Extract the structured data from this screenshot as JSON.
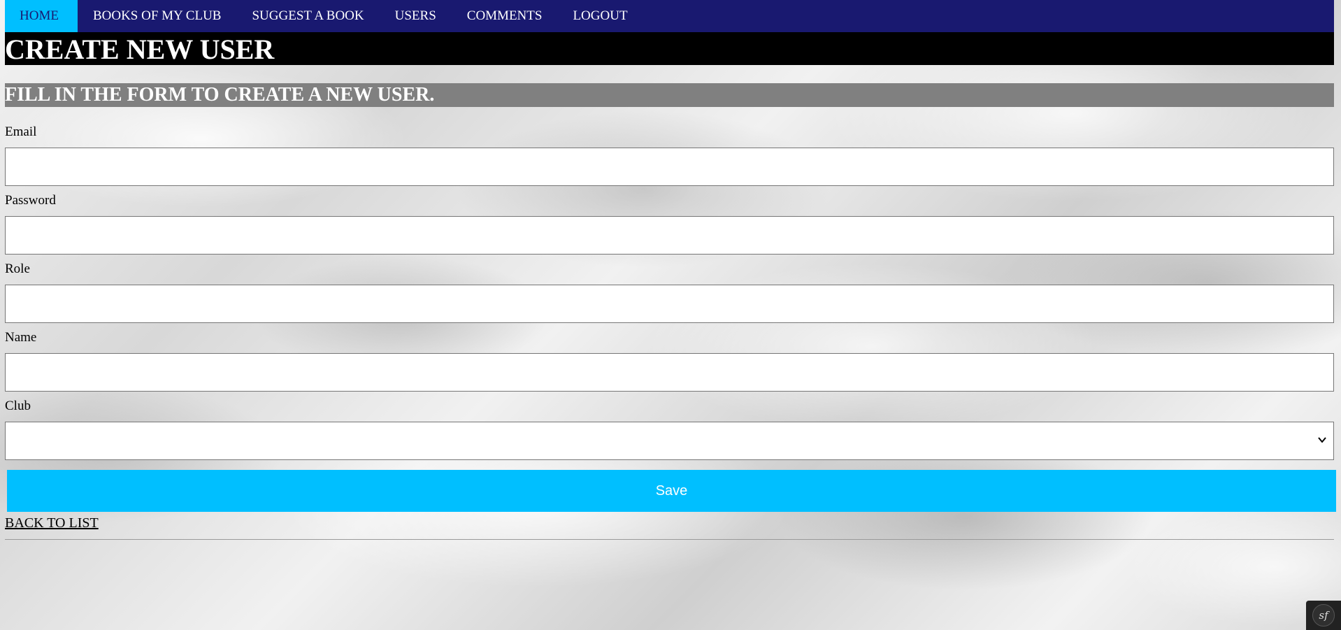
{
  "nav": {
    "items": [
      {
        "label": "HOME",
        "active": true
      },
      {
        "label": "BOOKS OF MY CLUB",
        "active": false
      },
      {
        "label": "SUGGEST A BOOK",
        "active": false
      },
      {
        "label": "USERS",
        "active": false
      },
      {
        "label": "COMMENTS",
        "active": false
      },
      {
        "label": "LOGOUT",
        "active": false
      }
    ]
  },
  "page": {
    "title": "CREATE NEW USER",
    "subtitle": "FILL IN THE FORM TO CREATE A NEW USER."
  },
  "form": {
    "email": {
      "label": "Email",
      "value": ""
    },
    "password": {
      "label": "Password",
      "value": ""
    },
    "role": {
      "label": "Role",
      "value": ""
    },
    "name": {
      "label": "Name",
      "value": ""
    },
    "club": {
      "label": "Club",
      "selected": ""
    },
    "save_label": "Save"
  },
  "back_link": "BACK TO LIST",
  "debug_toolbar": {
    "logo": "sf",
    "icon": "symfony-icon"
  },
  "colors": {
    "nav_background": "#191970",
    "nav_active": "#00bfff",
    "title_background": "#000000",
    "subtitle_background": "#808080",
    "save_button": "#00bfff"
  }
}
